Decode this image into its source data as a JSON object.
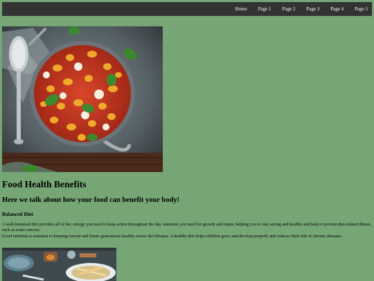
{
  "nav": {
    "items": [
      {
        "label": "Home"
      },
      {
        "label": "Page 1"
      },
      {
        "label": "Page 2"
      },
      {
        "label": "Page 3"
      },
      {
        "label": "Page 4"
      },
      {
        "label": "Page 5"
      }
    ]
  },
  "hero_image": {
    "icon": "food-pan-image"
  },
  "main": {
    "title": "Food Health Benefits",
    "subtitle": "Here we talk about how your food can benefit your body!",
    "section_heading": "Balanced Diet",
    "paragraph_1": "A well-balanced diet provides all of the: energy you need to keep active throughout the day. nutrients you need for growth and repair, helping you to stay strong and healthy and help to prevent diet-related illness, such as some cancers.",
    "paragraph_2": "Good nutrition is essential to keeping current and future generations healthy across the lifespan. A healthy diet helps children grow and develop properly and reduces their risk of chronic diseases."
  },
  "second_image": {
    "icon": "food-table-image"
  },
  "colors": {
    "background": "#76a676",
    "navbar": "#333333",
    "nav_text": "#ffffff"
  }
}
